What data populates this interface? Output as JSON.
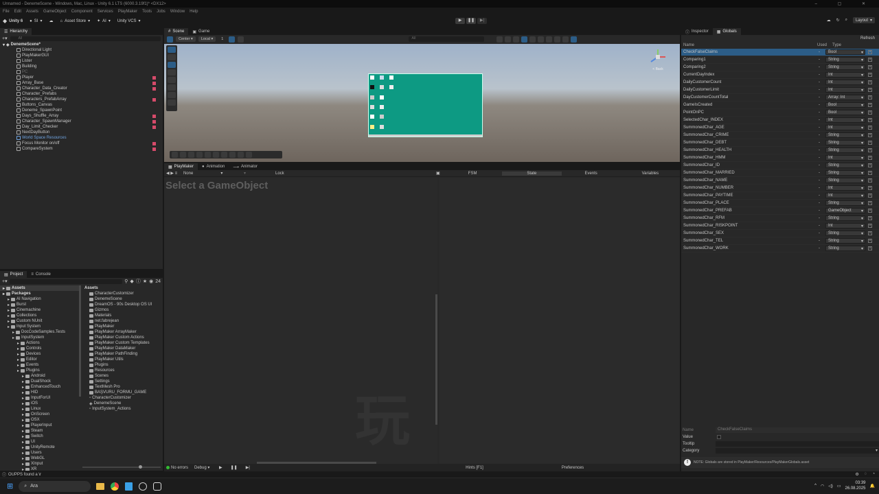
{
  "window": {
    "title": "Unnamed - DenemeScene - Windows, Mac, Linux - Unity 6.1 LTS (6000.3.19f1)* <DX12>",
    "menu": [
      "File",
      "Edit",
      "Assets",
      "GameObject",
      "Component",
      "Services",
      "PlayMaker",
      "Tools",
      "Jobs",
      "Window",
      "Help"
    ]
  },
  "toolbar": {
    "brand": "Unity 6",
    "account": "SI",
    "asset_store": "Asset Store",
    "ai": "AI",
    "vcs": "Unity VCS",
    "layout": "Layout"
  },
  "hierarchy": {
    "tab": "Hierarchy",
    "search_placeholder": "All",
    "scene": "DenemeScene*",
    "items": [
      {
        "label": "Directional Light",
        "badge": false,
        "dim": false
      },
      {
        "label": "PlayMakerGUI",
        "badge": false,
        "dim": false
      },
      {
        "label": "Lister",
        "badge": false,
        "dim": false
      },
      {
        "label": "Building",
        "badge": false,
        "dim": false
      },
      {
        "label": "PC",
        "badge": false,
        "dim": true
      },
      {
        "label": "Player",
        "badge": true,
        "dim": false
      },
      {
        "label": "Array_Base",
        "badge": true,
        "dim": false
      },
      {
        "label": "Character_Data_Creator",
        "badge": true,
        "dim": false
      },
      {
        "label": "Character_Prefabs",
        "badge": false,
        "dim": false
      },
      {
        "label": "Characters_PrefabArray",
        "badge": true,
        "dim": false
      },
      {
        "label": "Buttons_Canvas",
        "badge": false,
        "dim": false
      },
      {
        "label": "Deneme_SpawnPoint",
        "badge": false,
        "dim": false
      },
      {
        "label": "Days_Shuffle_Array",
        "badge": true,
        "dim": false
      },
      {
        "label": "Character_SpawnManager",
        "badge": true,
        "dim": false
      },
      {
        "label": "Day_Limit_Checker",
        "badge": true,
        "dim": false
      },
      {
        "label": "NextDayButton",
        "badge": false,
        "dim": false
      },
      {
        "label": "World Space Resources",
        "badge": false,
        "dim": false,
        "highlight": true
      },
      {
        "label": "Focus Monitor on/off",
        "badge": true,
        "dim": false
      },
      {
        "label": "CompareSystem",
        "badge": true,
        "dim": false
      }
    ]
  },
  "scene_view": {
    "tabs": [
      "Scene",
      "Game"
    ],
    "pivot": "Center",
    "space": "Local",
    "snap_value": "1",
    "search_placeholder": "All",
    "gizmo_label": "< Back"
  },
  "playmaker": {
    "tabs": [
      "PlayMaker",
      "Animation",
      "Animator"
    ],
    "selection": "None",
    "lock": "Lock",
    "columns": [
      "FSM",
      "State",
      "Events",
      "Variables"
    ],
    "placeholder": "Select a GameObject",
    "watermark": "玩",
    "footer": {
      "status": "No errors",
      "debug": "Debug",
      "hints": "Hints [F1]",
      "prefs": "Preferences"
    }
  },
  "project": {
    "tabs": [
      "Project",
      "Console"
    ],
    "count": "24",
    "tree": [
      {
        "label": "Assets",
        "depth": 0,
        "bold": true
      },
      {
        "label": "Packages",
        "depth": 0,
        "bold": true
      },
      {
        "label": "AI Navigation",
        "depth": 1
      },
      {
        "label": "Burst",
        "depth": 1
      },
      {
        "label": "Cinemachine",
        "depth": 1
      },
      {
        "label": "Collections",
        "depth": 1
      },
      {
        "label": "Custom NUnit",
        "depth": 1
      },
      {
        "label": "Input System",
        "depth": 1
      },
      {
        "label": "DocCodeSamples.Tests",
        "depth": 2
      },
      {
        "label": "InputSystem",
        "depth": 2
      },
      {
        "label": "Actions",
        "depth": 3
      },
      {
        "label": "Controls",
        "depth": 3
      },
      {
        "label": "Devices",
        "depth": 3
      },
      {
        "label": "Editor",
        "depth": 3
      },
      {
        "label": "Events",
        "depth": 3
      },
      {
        "label": "Plugins",
        "depth": 3
      },
      {
        "label": "Android",
        "depth": 4
      },
      {
        "label": "DualShock",
        "depth": 4
      },
      {
        "label": "EnhancedTouch",
        "depth": 4
      },
      {
        "label": "HID",
        "depth": 4
      },
      {
        "label": "InputForUI",
        "depth": 4
      },
      {
        "label": "iOS",
        "depth": 4
      },
      {
        "label": "Linux",
        "depth": 4
      },
      {
        "label": "OnScreen",
        "depth": 4
      },
      {
        "label": "OSX",
        "depth": 4
      },
      {
        "label": "PlayerInput",
        "depth": 4
      },
      {
        "label": "Steam",
        "depth": 4
      },
      {
        "label": "Switch",
        "depth": 4
      },
      {
        "label": "UI",
        "depth": 4
      },
      {
        "label": "UnityRemote",
        "depth": 4
      },
      {
        "label": "Users",
        "depth": 4
      },
      {
        "label": "WebGL",
        "depth": 4
      },
      {
        "label": "XInput",
        "depth": 4
      },
      {
        "label": "XR",
        "depth": 4
      }
    ],
    "assets_header": "Assets",
    "assets": [
      {
        "label": "CharacterCustomizer",
        "kind": "folder"
      },
      {
        "label": "DenemeScene",
        "kind": "folder"
      },
      {
        "label": "DreamOS - 90s Desktop OS UI",
        "kind": "folder"
      },
      {
        "label": "Gizmos",
        "kind": "folder"
      },
      {
        "label": "Materials",
        "kind": "folder"
      },
      {
        "label": "net.fabrejean",
        "kind": "folder"
      },
      {
        "label": "PlayMaker",
        "kind": "folder"
      },
      {
        "label": "PlayMaker ArrayMaker",
        "kind": "folder"
      },
      {
        "label": "PlayMaker Custom Actions",
        "kind": "folder"
      },
      {
        "label": "PlayMaker Custom Templates",
        "kind": "folder"
      },
      {
        "label": "PlayMaker DataMaker",
        "kind": "folder"
      },
      {
        "label": "PlayMaker PathFinding",
        "kind": "folder"
      },
      {
        "label": "PlayMaker Utils",
        "kind": "folder"
      },
      {
        "label": "Plugins",
        "kind": "folder"
      },
      {
        "label": "Resources",
        "kind": "folder"
      },
      {
        "label": "Scenes",
        "kind": "folder"
      },
      {
        "label": "Settings",
        "kind": "folder"
      },
      {
        "label": "TextMesh Pro",
        "kind": "folder"
      },
      {
        "label": "BAŞVURU_FORMU_GAME",
        "kind": "folder"
      },
      {
        "label": "CharacterCustomizer",
        "kind": "file"
      },
      {
        "label": "DenemeScene",
        "kind": "unity"
      },
      {
        "label": "InputSystem_Actions",
        "kind": "file"
      }
    ]
  },
  "globals": {
    "tabs": [
      "Inspector",
      "Globals"
    ],
    "refresh": "Refresh",
    "headers": {
      "name": "Name",
      "used": "Used",
      "type": "Type"
    },
    "rows": [
      {
        "name": "CheckFalseClaims",
        "type": "Bool"
      },
      {
        "name": "Comparing1",
        "type": "String"
      },
      {
        "name": "Comparing2",
        "type": "String"
      },
      {
        "name": "CurrentDayIndex",
        "type": "Int"
      },
      {
        "name": "DailyCustomerCount",
        "type": "Int"
      },
      {
        "name": "DailyCustomerLimit",
        "type": "Int"
      },
      {
        "name": "DayCustomerCountTotal",
        "type": "Array: Int"
      },
      {
        "name": "GameIsCreated",
        "type": "Bool"
      },
      {
        "name": "PointOnPC",
        "type": "Bool"
      },
      {
        "name": "SelectedChar_INDEX",
        "type": "Int"
      },
      {
        "name": "SummonedChar_AGE",
        "type": "Int"
      },
      {
        "name": "SummonedChar_CRIME",
        "type": "String"
      },
      {
        "name": "SummonedChar_DEBT",
        "type": "String"
      },
      {
        "name": "SummonedChar_HEALTH",
        "type": "String"
      },
      {
        "name": "SummonedChar_HMM",
        "type": "Int"
      },
      {
        "name": "SummonedChar_ID",
        "type": "String"
      },
      {
        "name": "SummonedChar_MARRIED",
        "type": "String"
      },
      {
        "name": "SummonedChar_NAME",
        "type": "String"
      },
      {
        "name": "SummonedChar_NUMBER",
        "type": "Int"
      },
      {
        "name": "SummonedChar_PAYTIME",
        "type": "Int"
      },
      {
        "name": "SummonedChar_PLACE",
        "type": "String"
      },
      {
        "name": "SummonedChar_PREFAB",
        "type": "GameObject"
      },
      {
        "name": "SummonedChar_RFM",
        "type": "String"
      },
      {
        "name": "SummonedChar_RISKPOINT",
        "type": "Int"
      },
      {
        "name": "SummonedChar_SEX",
        "type": "String"
      },
      {
        "name": "SummonedChar_TEL",
        "type": "String"
      },
      {
        "name": "SummonedChar_WORK",
        "type": "String"
      }
    ],
    "detail": {
      "name_label": "Name",
      "name_value": "CheckFalseClaims",
      "value_label": "Value",
      "tooltip_label": "Tooltip",
      "category_label": "Category",
      "note": "NOTE: Globals are stored in PlayMaker/Resources/PlayMakerGlobals.asset"
    }
  },
  "statusbar": {
    "message": "OUPPS found a \\r"
  },
  "taskbar": {
    "search": "Ara",
    "time": "03:39",
    "date": "26.08.2025"
  },
  "colors": {
    "accent": "#2c5d87",
    "viewport_ui": "#0d9a83",
    "badge": "#d64a6a"
  }
}
